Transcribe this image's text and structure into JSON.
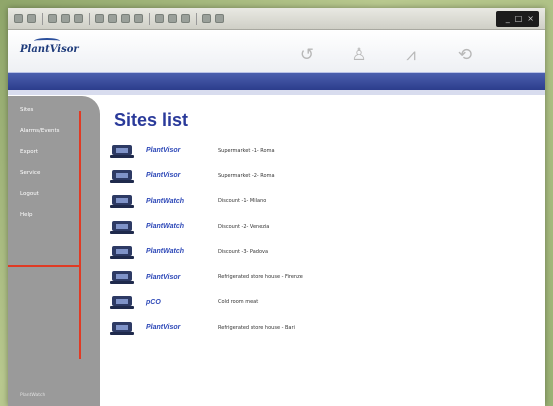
{
  "browser": {
    "wincontrols": [
      "_",
      "□",
      "×"
    ]
  },
  "app": {
    "logo": "PlantVisor"
  },
  "sidebar": {
    "items": [
      {
        "label": "Sites"
      },
      {
        "label": "Alarms/Events"
      },
      {
        "label": "Export"
      },
      {
        "label": "Service"
      },
      {
        "label": "Logout"
      },
      {
        "label": "Help"
      }
    ],
    "footer": "PlantWatch"
  },
  "main": {
    "title": "Sites list",
    "sites": [
      {
        "type": "PlantVisor",
        "name": "Supermarket -1- Roma"
      },
      {
        "type": "PlantVisor",
        "name": "Supermarket -2- Roma"
      },
      {
        "type": "PlantWatch",
        "name": "Discount -1- Milano"
      },
      {
        "type": "PlantWatch",
        "name": "Discount -2- Venezia"
      },
      {
        "type": "PlantWatch",
        "name": "Discount -3- Padova"
      },
      {
        "type": "PlantVisor",
        "name": "Refrigerated store house - Firenze"
      },
      {
        "type": "pCO",
        "name": "Cold room meat"
      },
      {
        "type": "PlantVisor",
        "name": "Refrigerated store house - Bari"
      }
    ]
  },
  "colors": {
    "accent_blue": "#2a3a9a",
    "band_blue": "#2c3d8c",
    "sidebar_gray": "#9a9a9a",
    "callout_red": "#e03a24"
  }
}
